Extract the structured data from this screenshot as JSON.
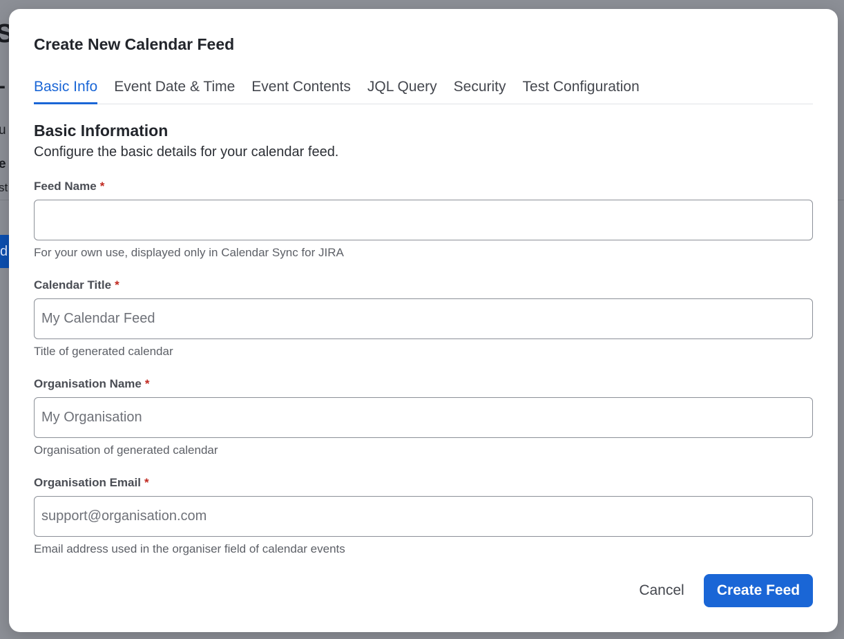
{
  "background": {
    "fragments": [
      "S",
      "-",
      "u",
      "e",
      "st",
      "d"
    ]
  },
  "modal": {
    "title": "Create New Calendar Feed",
    "tabs": [
      {
        "label": "Basic Info",
        "active": true
      },
      {
        "label": "Event Date & Time",
        "active": false
      },
      {
        "label": "Event Contents",
        "active": false
      },
      {
        "label": "JQL Query",
        "active": false
      },
      {
        "label": "Security",
        "active": false
      },
      {
        "label": "Test Configuration",
        "active": false
      }
    ],
    "section": {
      "title": "Basic Information",
      "subtitle": "Configure the basic details for your calendar feed."
    },
    "fields": [
      {
        "label": "Feed Name",
        "required_mark": "*",
        "value": "",
        "placeholder": "",
        "help": "For your own use, displayed only in Calendar Sync for JIRA"
      },
      {
        "label": "Calendar Title",
        "required_mark": "*",
        "value": "",
        "placeholder": "My Calendar Feed",
        "help": "Title of generated calendar"
      },
      {
        "label": "Organisation Name",
        "required_mark": "*",
        "value": "",
        "placeholder": "My Organisation",
        "help": "Organisation of generated calendar"
      },
      {
        "label": "Organisation Email",
        "required_mark": "*",
        "value": "",
        "placeholder": "support@organisation.com",
        "help": "Email address used in the organiser field of calendar events"
      }
    ],
    "footer": {
      "cancel_label": "Cancel",
      "create_label": "Create Feed"
    }
  },
  "colors": {
    "accent": "#1a66d6",
    "required": "#c0281f",
    "overlay": "#8c8f96"
  }
}
